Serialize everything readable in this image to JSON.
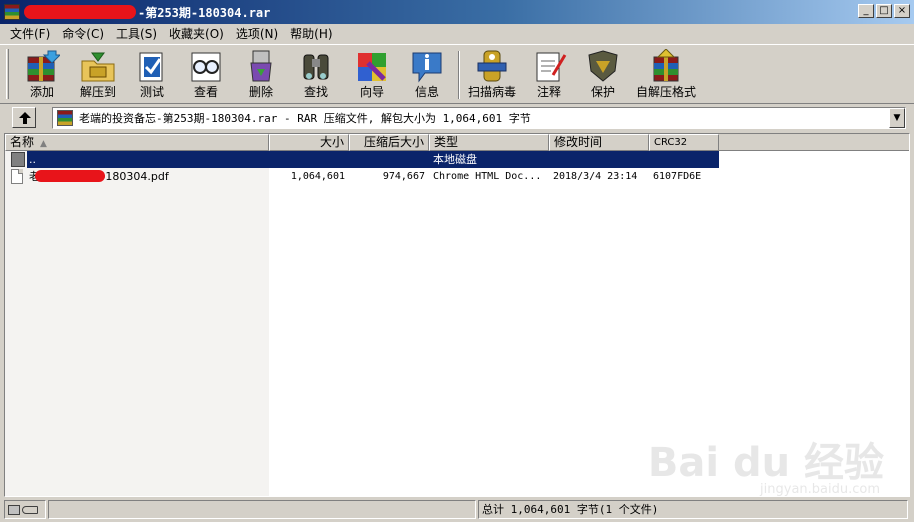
{
  "window": {
    "title": "-第253期-180304.rar",
    "controls": {
      "minimize": "_",
      "maximize": "□",
      "close": "×"
    }
  },
  "menu": [
    {
      "label": "文件(F)"
    },
    {
      "label": "命令(C)"
    },
    {
      "label": "工具(S)"
    },
    {
      "label": "收藏夹(O)"
    },
    {
      "label": "选项(N)"
    },
    {
      "label": "帮助(H)"
    }
  ],
  "toolbar": {
    "add": "添加",
    "extract": "解压到",
    "test": "测试",
    "view": "查看",
    "delete": "删除",
    "find": "查找",
    "wizard": "向导",
    "info": "信息",
    "scan": "扫描病毒",
    "comment": "注释",
    "protect": "保护",
    "sfx": "自解压格式"
  },
  "address": {
    "text": "老端的投资备忘-第253期-180304.rar - RAR 压缩文件, 解包大小为 1,064,601 字节",
    "dropdown": "▼"
  },
  "columns": {
    "name": "名称",
    "size": "大小",
    "packed": "压缩后大小",
    "type": "类型",
    "modified": "修改时间",
    "crc": "CRC32"
  },
  "rows": [
    {
      "name": "..",
      "size": "",
      "packed": "",
      "type": "本地磁盘",
      "modified": "",
      "crc": "",
      "selected": true
    },
    {
      "name": "老   忘-第253期-180304.pdf",
      "size": "1,064,601",
      "packed": "974,667",
      "type": "Chrome HTML Doc...",
      "modified": "2018/3/4 23:14",
      "crc": "6107FD6E",
      "selected": false
    }
  ],
  "status": {
    "summary": "总计 1,064,601 字节(1 个文件)"
  },
  "watermark": {
    "brand": "Bai du 经验",
    "url": "jingyan.baidu.com"
  }
}
